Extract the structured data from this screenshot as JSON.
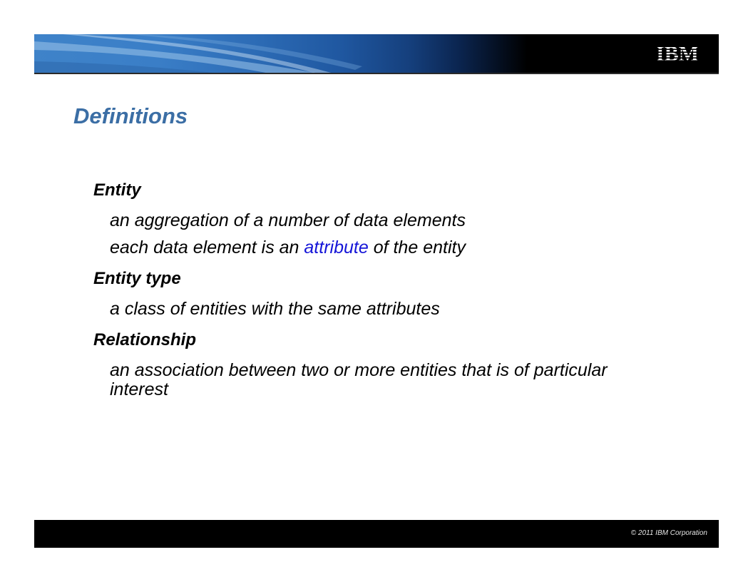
{
  "header": {
    "logo_text": "IBM"
  },
  "title": "Definitions",
  "definitions": [
    {
      "term": "Entity",
      "lines": [
        {
          "text": "an aggregation of a number of data elements"
        },
        {
          "before": "each data element is an ",
          "link": "attribute",
          "after": " of the entity"
        }
      ]
    },
    {
      "term": "Entity type",
      "lines": [
        {
          "text": "a class of entities with the same attributes"
        }
      ]
    },
    {
      "term": "Relationship",
      "lines": [
        {
          "text": "an association between two or more entities that is of particular interest"
        }
      ]
    }
  ],
  "footer": {
    "copyright": "© 2011  IBM Corporation"
  },
  "colors": {
    "title": "#3b6ea5",
    "link": "#1515d8",
    "footer_bg": "#000000"
  }
}
